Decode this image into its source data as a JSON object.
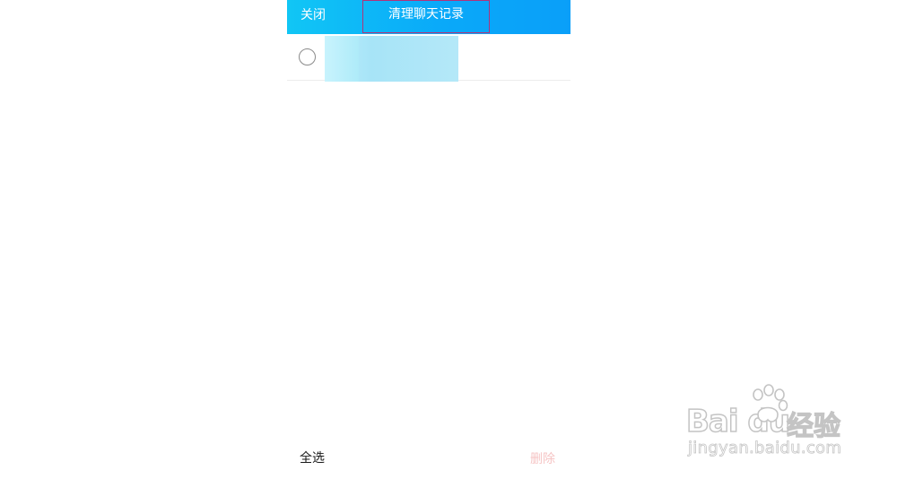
{
  "header": {
    "close_label": "关闭",
    "title": "清理聊天记录"
  },
  "list": {
    "items": [
      {
        "selected": false,
        "content_redacted": true
      }
    ]
  },
  "footer": {
    "select_all_label": "全选",
    "delete_label": "删除"
  },
  "watermark": {
    "logo_text": "Bai du",
    "jingyan_text": "经验",
    "url": "jingyan.baidu.com"
  },
  "colors": {
    "header_gradient_start": "#11c6f5",
    "header_gradient_end": "#0a9ff9",
    "title_highlight_border": "#b0347a",
    "delete_disabled": "#f6c4c4"
  }
}
